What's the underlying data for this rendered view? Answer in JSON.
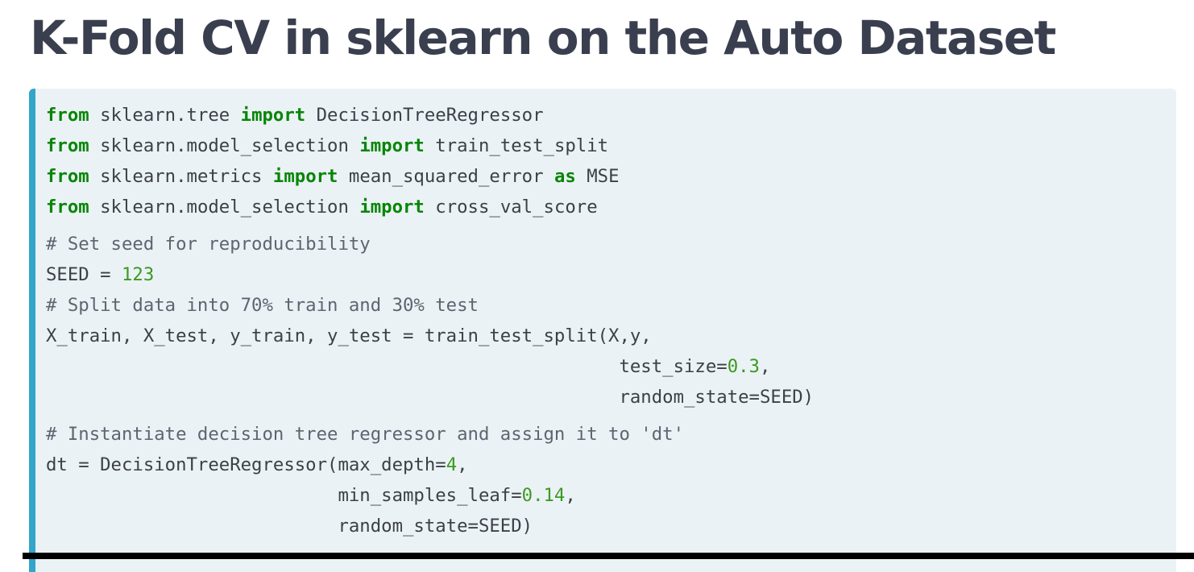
{
  "slide": {
    "title": "K-Fold CV in sklearn on the Auto Dataset"
  },
  "colors": {
    "title": "#3a3f4f",
    "code_background": "#ebf2f5",
    "code_accent_bar": "#33a5c9",
    "keyword": "#078506",
    "number": "#3a9a20",
    "comment": "#5f6470",
    "text": "#3c3f48"
  },
  "code": {
    "l1": {
      "kw1": "from",
      "mod": " sklearn.tree ",
      "kw2": "import",
      "name": " DecisionTreeRegressor"
    },
    "l2": {
      "kw1": "from",
      "mod": " sklearn.model_selection ",
      "kw2": "import",
      "name": " train_test_split"
    },
    "l3": {
      "kw1": "from",
      "mod": " sklearn.metrics ",
      "kw2": "import",
      "name": " mean_squared_error ",
      "kw3": "as",
      "alias": " MSE"
    },
    "l4": {
      "kw1": "from",
      "mod": " sklearn.model_selection ",
      "kw2": "import",
      "name": " cross_val_score"
    },
    "l5": {
      "comment": "# Set seed for reproducibility"
    },
    "l6": {
      "pre": "SEED = ",
      "num": "123"
    },
    "l7": {
      "comment": "# Split data into 70% train and 30% test"
    },
    "l8": {
      "text": "X_train, X_test, y_train, y_test = train_test_split(X,y,"
    },
    "l9": {
      "pre": "                                                     test_size=",
      "num": "0.3",
      "post": ","
    },
    "l10": {
      "text": "                                                     random_state=SEED)"
    },
    "l11": {
      "comment": "# Instantiate decision tree regressor and assign it to 'dt'"
    },
    "l12": {
      "pre": "dt = DecisionTreeRegressor(max_depth=",
      "num": "4",
      "post": ","
    },
    "l13": {
      "pre": "                           min_samples_leaf=",
      "num": "0.14",
      "post": ","
    },
    "l14": {
      "text": "                           random_state=SEED)"
    }
  }
}
